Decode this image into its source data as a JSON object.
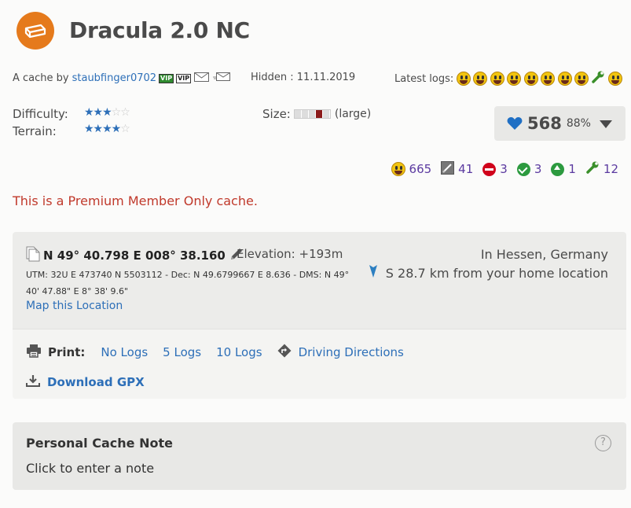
{
  "header": {
    "title": "Dracula 2.0 NC",
    "icon": "letterbox-cache-icon",
    "icon_color": "#e57a1c"
  },
  "owner": {
    "prefix": "A cache by",
    "name": "staubfinger0702",
    "badge_1": "VIP",
    "badge_2": "VIP"
  },
  "hidden": "Hidden : 11.11.2019",
  "latest_logs": {
    "label": "Latest logs:",
    "icons": [
      "found",
      "found",
      "found",
      "found",
      "found",
      "found",
      "found",
      "found",
      "maintenance",
      "found"
    ]
  },
  "ratings": {
    "difficulty_label": "Difficulty:",
    "difficulty": 3,
    "terrain_label": "Terrain:",
    "terrain": 4,
    "max": 5,
    "size_label": "Size:",
    "size_text": "(large)",
    "size_level": 4
  },
  "favorites": {
    "count": "568",
    "percent": "88%"
  },
  "log_counts": {
    "found": "665",
    "write_note": "41",
    "dnf": "3",
    "attended": "3",
    "owner_maintenance": "1",
    "needs_maintenance": "12"
  },
  "premium_notice": "This is a Premium Member Only cache.",
  "coordinates": {
    "main": "N 49° 40.798 E 008° 38.160",
    "elevation": "Elevation: +193m",
    "utm": "UTM: 32U E 473740 N 5503112 - Dec: N 49.6799667 E 8.636 - DMS: N 49° 40' 47.88\" E 8° 38' 9.6\"",
    "map_link": "Map this Location",
    "location": "In Hessen, Germany",
    "distance": "S 28.7 km from your home location"
  },
  "print": {
    "label": "Print:",
    "no_logs": "No Logs",
    "five_logs": "5 Logs",
    "ten_logs": "10 Logs",
    "driving": "Driving Directions",
    "download": "Download GPX"
  },
  "note": {
    "title": "Personal Cache Note",
    "placeholder": "Click to enter a note",
    "help": "?"
  },
  "colors": {
    "link": "#2d6fb8",
    "premium": "#c0392b",
    "count_text": "#5b3aa0"
  }
}
